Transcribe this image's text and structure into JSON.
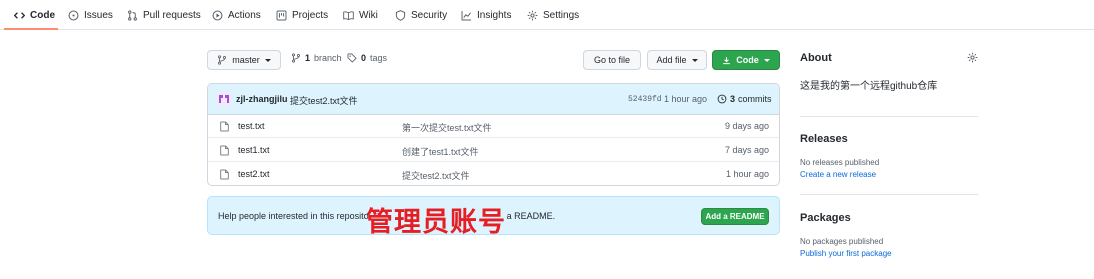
{
  "nav": {
    "tabs": [
      {
        "label": "Code",
        "icon": "code-icon"
      },
      {
        "label": "Issues",
        "icon": "issue-icon"
      },
      {
        "label": "Pull requests",
        "icon": "pull-request-icon"
      },
      {
        "label": "Actions",
        "icon": "play-icon"
      },
      {
        "label": "Projects",
        "icon": "project-icon"
      },
      {
        "label": "Wiki",
        "icon": "book-icon"
      },
      {
        "label": "Security",
        "icon": "shield-icon"
      },
      {
        "label": "Insights",
        "icon": "graph-icon"
      },
      {
        "label": "Settings",
        "icon": "gear-icon"
      }
    ],
    "active_tab": "Code",
    "accent": "#fd8c73"
  },
  "branch": {
    "name": "master",
    "branch_count": "1",
    "branch_label": "branch",
    "tag_count": "0",
    "tag_label": "tags"
  },
  "actions": {
    "go_to_file": "Go to file",
    "add_file": "Add file",
    "code": "Code",
    "code_color": "#2da44e"
  },
  "commit": {
    "author": "zjl-zhangjilu",
    "message": "提交test2.txt文件",
    "hash": "52439fd",
    "time": "1 hour ago",
    "count": "3",
    "count_label": "commits"
  },
  "files": [
    {
      "name": "test.txt",
      "message": "第一次提交test.txt文件",
      "date": "9 days ago"
    },
    {
      "name": "test1.txt",
      "message": "创建了test1.txt文件",
      "date": "7 days ago"
    },
    {
      "name": "test2.txt",
      "message": "提交test2.txt文件",
      "date": "1 hour ago"
    }
  ],
  "readme": {
    "text_start": "Help people interested in this reposito",
    "text_end": "a README.",
    "button": "Add a README"
  },
  "overlay_text": "管理员账号",
  "sidebar": {
    "about_title": "About",
    "description": "这是我的第一个远程github仓库",
    "releases_title": "Releases",
    "releases_empty": "No releases published",
    "releases_link": "Create a new release",
    "packages_title": "Packages",
    "packages_empty": "No packages published",
    "packages_link": "Publish your first package"
  }
}
